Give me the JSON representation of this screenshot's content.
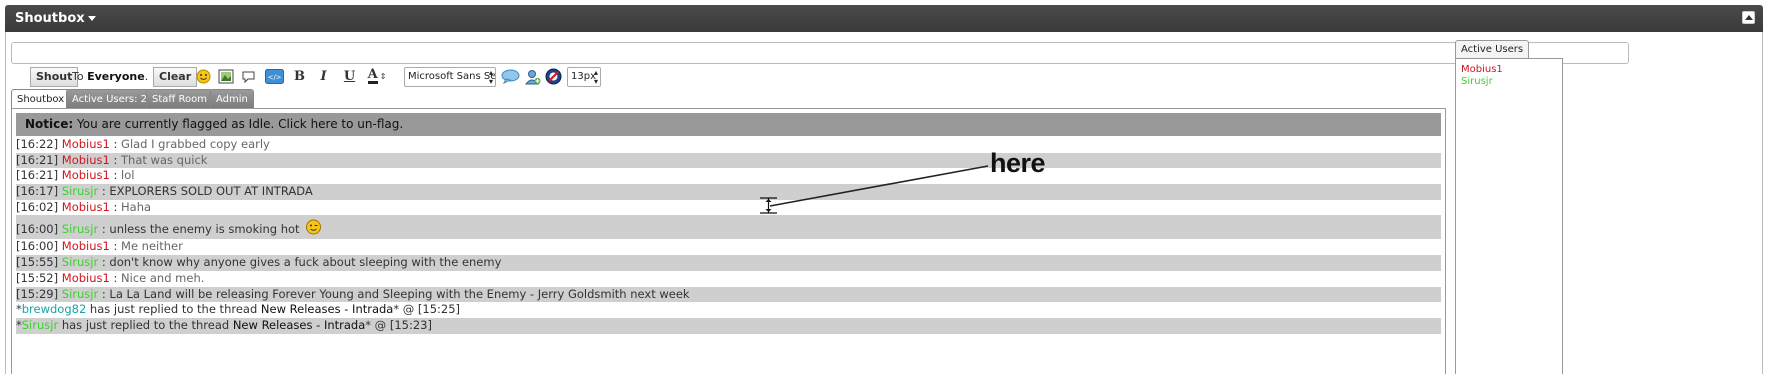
{
  "header": {
    "title": "Shoutbox"
  },
  "toolbar": {
    "shout_label": "Shout",
    "to_prefix": "To",
    "to_target": "Everyone",
    "to_suffix": ".",
    "clear_label": "Clear",
    "bold_label": "B",
    "italic_label": "I",
    "underline_label": "U",
    "font_color_label": "A",
    "font_family": "Microsoft Sans Serif",
    "font_size": "13px",
    "code_label": "</>"
  },
  "tabs": [
    {
      "label": "Shoutbox",
      "active": true
    },
    {
      "label": "Active Users: 2"
    },
    {
      "label": "Staff Room"
    },
    {
      "label": "Admin"
    }
  ],
  "notice": {
    "label": "Notice:",
    "text": "You are currently flagged as Idle. Click here to un-flag."
  },
  "messages": [
    {
      "time": "[16:22]",
      "user": "Mobius1",
      "sep": " : ",
      "text": "Glad I grabbed copy early"
    },
    {
      "time": "[16:21]",
      "user": "Mobius1",
      "sep": " : ",
      "text": "That was quick"
    },
    {
      "time": "[16:21]",
      "user": "Mobius1",
      "sep": " : ",
      "text": "lol"
    },
    {
      "time": "[16:17]",
      "user": "Sirusjr",
      "sep": " : ",
      "text": "EXPLORERS SOLD OUT AT INTRADA"
    },
    {
      "time": "[16:02]",
      "user": "Mobius1",
      "sep": " : ",
      "text": "Haha"
    },
    {
      "time": "[16:00]",
      "user": "Sirusjr",
      "sep": " : ",
      "text": "unless the enemy is smoking hot"
    },
    {
      "time": "[16:00]",
      "user": "Mobius1",
      "sep": " : ",
      "text": "Me neither"
    },
    {
      "time": "[15:55]",
      "user": "Sirusjr",
      "sep": " : ",
      "text": "don't know why anyone gives a fuck about sleeping with the enemy"
    },
    {
      "time": "[15:52]",
      "user": "Mobius1",
      "sep": " : ",
      "text": "Nice and meh."
    },
    {
      "time": "[15:29]",
      "user": "Sirusjr",
      "sep": " : ",
      "text": "La La Land will be releasing Forever Young and Sleeping with the Enemy - Jerry Goldsmith next week"
    }
  ],
  "system_messages": [
    {
      "star": "*",
      "user": "brewdog82",
      "text": " has just replied to the thread ",
      "thread": "New Releases - Intrada",
      "tail": "* @ [15:25]"
    },
    {
      "star": "*",
      "user": "Sirusjr",
      "text": " has just replied to the thread ",
      "thread": "New Releases - Intrada",
      "tail": "* @ [15:23]"
    }
  ],
  "annotation": {
    "text": "here"
  },
  "sidebar": {
    "tab_label": "Active Users",
    "users": [
      {
        "name": "Mobius1"
      },
      {
        "name": "Sirusjr"
      }
    ]
  },
  "colors": {
    "titlebar": "#3f3f3f",
    "user_red": "#d0161d",
    "user_green": "#3bd12e",
    "user_teal": "#1aa3a3",
    "notice_bg": "#999999",
    "alt_row": "#cfcfcf"
  },
  "icons": [
    "smiley-icon",
    "image-icon",
    "speech-bubble-icon",
    "code-icon",
    "chat-bubble-icon",
    "add-user-icon",
    "no-entry-icon"
  ]
}
